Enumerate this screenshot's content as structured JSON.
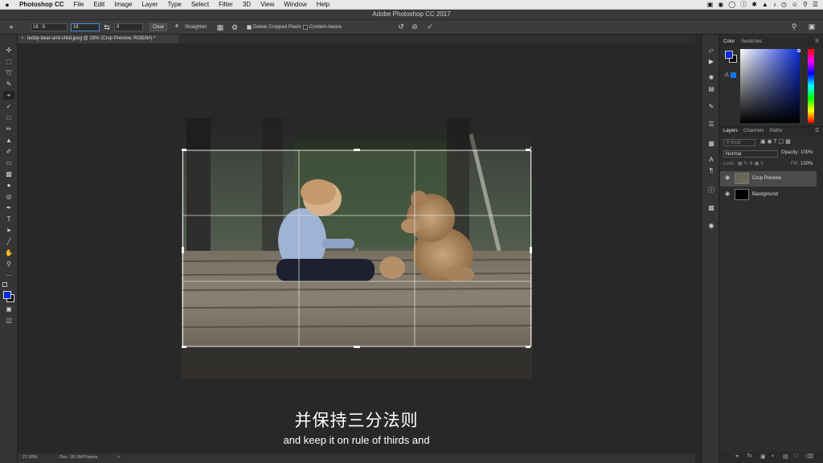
{
  "menubar": {
    "apple": "",
    "items": [
      "Photoshop CC",
      "File",
      "Edit",
      "Image",
      "Layer",
      "Type",
      "Select",
      "Filter",
      "3D",
      "View",
      "Window",
      "Help"
    ],
    "status_icons": [
      "wifi-icon",
      "volume-icon",
      "bluetooth-icon",
      "clock-icon",
      "search-icon",
      "menu-icon"
    ]
  },
  "window": {
    "title": "Adobe Photoshop CC 2017"
  },
  "options": {
    "ratio": "16 : 9",
    "width_value": "16",
    "height_value": "9",
    "clear_label": "Clear",
    "straighten_label": "Straighten",
    "delete_cropped_label": "Delete Cropped Pixels",
    "content_aware_label": "Content-Aware"
  },
  "document": {
    "tab_title": "teddy-bear-and-child.jpeg @ 28% (Crop Preview, RGB/8#) *",
    "close_glyph": "×"
  },
  "status": {
    "zoom": "27.99%",
    "doc_info": "Doc: 18.1M/0 bytes",
    "arrow": ">"
  },
  "subtitles": {
    "chinese": "并保持三分法则",
    "english": "and keep it on rule of thirds and"
  },
  "panels": {
    "color_tabs": [
      "Color",
      "Swatches"
    ],
    "layers_tabs": [
      "Layers",
      "Channels",
      "Paths"
    ],
    "search_placeholder": "Kind",
    "blend_mode": "Normal",
    "opacity_label": "Opacity:",
    "opacity_value": "100%",
    "lock_label": "Lock:",
    "fill_label": "Fill:",
    "fill_value": "100%",
    "layers": [
      {
        "name": "Crop Preview"
      },
      {
        "name": "Background"
      }
    ]
  },
  "colors": {
    "foreground": "#0a2bd8",
    "background": "#000000",
    "accent": "#1473e6"
  }
}
